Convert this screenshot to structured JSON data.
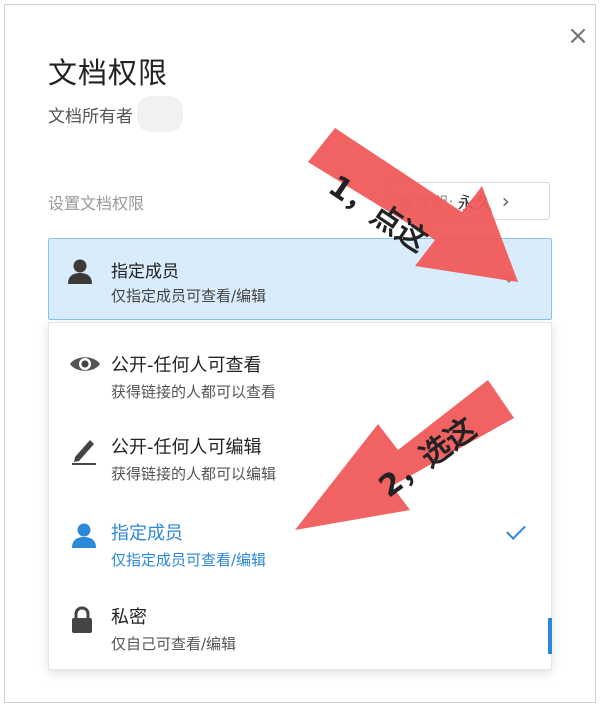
{
  "dialog": {
    "close_glyph": "×",
    "title": "文档权限",
    "owner_label": "文档所有者"
  },
  "settings": {
    "section_label": "设置文档权限",
    "validity_label": "有效期:",
    "validity_value": "永久",
    "validity_chevron": "›"
  },
  "current_selection": {
    "icon": "person-icon",
    "label": "指定成员",
    "description": "仅指定成员可查看/编辑"
  },
  "options": [
    {
      "icon": "eye-icon",
      "label": "公开-任何人可查看",
      "description": "获得链接的人都可以查看",
      "selected": false
    },
    {
      "icon": "pencil-icon",
      "label": "公开-任何人可编辑",
      "description": "获得链接的人都可以编辑",
      "selected": false
    },
    {
      "icon": "person-icon",
      "label": "指定成员",
      "description": "仅指定成员可查看/编辑",
      "selected": true
    },
    {
      "icon": "lock-icon",
      "label": "私密",
      "description": "仅自己可查看/编辑",
      "selected": false
    }
  ],
  "annotations": {
    "arrow1_text": "1，点这",
    "arrow2_text": "2，选这",
    "arrow_color": "#f05a5a"
  },
  "colors": {
    "accent": "#2c88d8",
    "selected_bg": "#d9ecfb",
    "selected_border": "#8cc4ee"
  }
}
